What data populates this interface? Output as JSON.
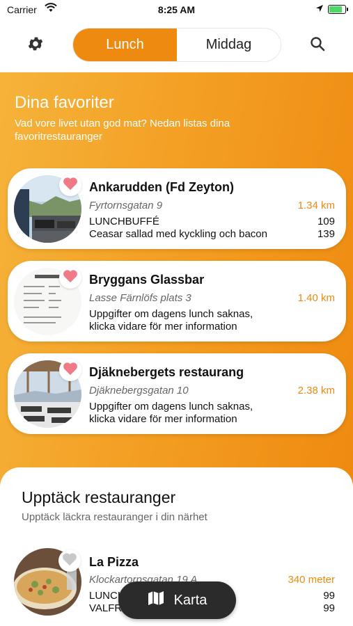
{
  "status_bar": {
    "carrier": "Carrier",
    "time": "8:25 AM"
  },
  "segmented": {
    "lunch_label": "Lunch",
    "dinner_label": "Middag",
    "active": "lunch"
  },
  "favorites": {
    "title": "Dina favoriter",
    "subtitle": "Vad vore livet utan god mat? Nedan listas dina favoritrestauranger",
    "restaurants": [
      {
        "name": "Ankarudden (Fd Zeyton)",
        "address": "Fyrtornsgatan 9",
        "distance": "1.34 km",
        "favorite": true,
        "lines": [
          {
            "text": "LUNCHBUFFÉ",
            "price": "109"
          },
          {
            "text": "Ceasar sallad med kyckling och bacon",
            "price": "139"
          }
        ]
      },
      {
        "name": "Bryggans Glassbar",
        "address": "Lasse Färnlöfs plats 3",
        "distance": "1.40 km",
        "favorite": true,
        "lines": [
          {
            "text": "Uppgifter om dagens lunch saknas,",
            "price": ""
          },
          {
            "text": "klicka vidare för mer information",
            "price": ""
          }
        ]
      },
      {
        "name": "Djäknebergets restaurang",
        "address": "Djäknebergsgatan 10",
        "distance": "2.38 km",
        "favorite": true,
        "lines": [
          {
            "text": "Uppgifter om dagens lunch saknas,",
            "price": ""
          },
          {
            "text": "klicka vidare för mer information",
            "price": ""
          }
        ]
      }
    ]
  },
  "discover": {
    "title": "Upptäck restauranger",
    "subtitle": "Upptäck läckra restauranger i din närhet",
    "restaurants": [
      {
        "name": "La Pizza",
        "address": "Klockartorpsgatan 19 A",
        "distance": "340 meter",
        "favorite": false,
        "lines": [
          {
            "text": "LUNCHBUFFÉ & PIZZ...",
            "price": "99"
          },
          {
            "text": "VALFRI PIZZA",
            "price": "99"
          }
        ]
      }
    ]
  },
  "map_button": {
    "label": "Karta",
    "icon": "map-icon"
  },
  "colors": {
    "accent": "#ef8a10",
    "gradient_light": "#f6b33a",
    "heart_active": "#f07b87",
    "heart_inactive": "#c8c8c8"
  },
  "icons": {
    "settings": "gear-icon",
    "search": "search-icon",
    "favorite": "heart-icon"
  }
}
